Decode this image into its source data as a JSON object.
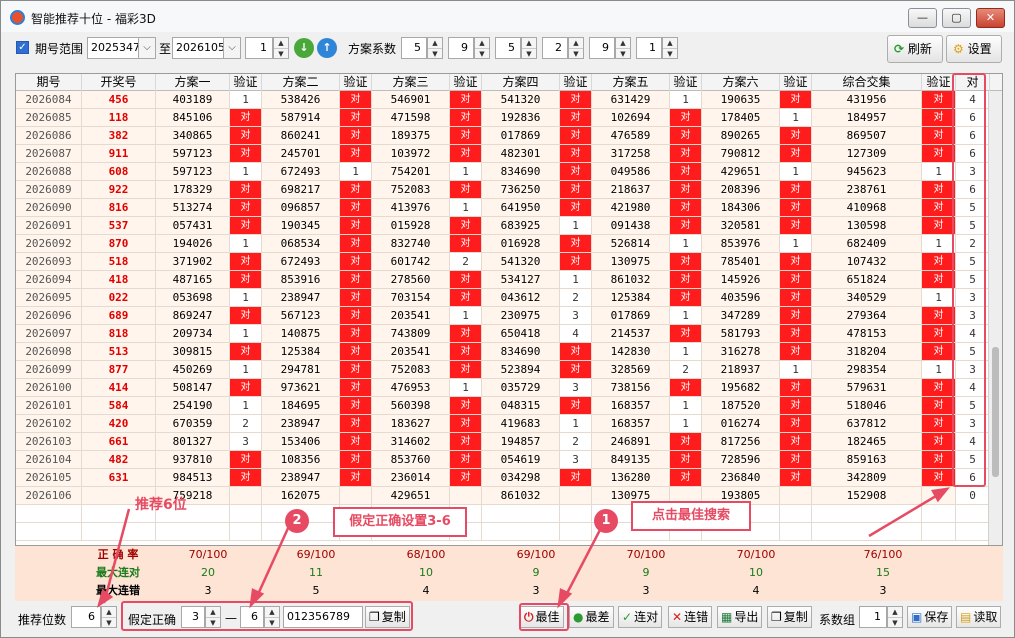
{
  "window": {
    "title": "智能推荐十位 - 福彩3D",
    "min_label": "—",
    "max_label": "▢",
    "close_label": "✕"
  },
  "toolbar": {
    "range_label": "期号范围",
    "range_checked": true,
    "from": "2025347",
    "to_label": "至",
    "to": "2026105",
    "step": "1",
    "coef_label": "方案系数",
    "coefs": [
      "5",
      "9",
      "5",
      "2",
      "9",
      "1"
    ],
    "refresh_label": "刷新",
    "settings_label": "设置"
  },
  "grid": {
    "headers": [
      "期号",
      "开奖号",
      "方案一",
      "验证",
      "方案二",
      "验证",
      "方案三",
      "验证",
      "方案四",
      "验证",
      "方案五",
      "验证",
      "方案六",
      "验证",
      "综合交集",
      "验证",
      "对"
    ],
    "rows": [
      {
        "period": "2026084",
        "draw": "456",
        "plans": [
          "403189",
          "538426",
          "546901",
          "541320",
          "631429",
          "190635",
          "431956"
        ],
        "checks": [
          "1",
          "对",
          "对",
          "对",
          "1",
          "对",
          "对"
        ],
        "count": "4"
      },
      {
        "period": "2026085",
        "draw": "118",
        "plans": [
          "845106",
          "587914",
          "471598",
          "192836",
          "102694",
          "178405",
          "184957"
        ],
        "checks": [
          "对",
          "对",
          "对",
          "对",
          "对",
          "1",
          "对"
        ],
        "count": "6"
      },
      {
        "period": "2026086",
        "draw": "382",
        "plans": [
          "340865",
          "860241",
          "189375",
          "017869",
          "476589",
          "890265",
          "869507"
        ],
        "checks": [
          "对",
          "对",
          "对",
          "对",
          "对",
          "对",
          "对"
        ],
        "count": "6"
      },
      {
        "period": "2026087",
        "draw": "911",
        "plans": [
          "597123",
          "245701",
          "103972",
          "482301",
          "317258",
          "790812",
          "127309"
        ],
        "checks": [
          "对",
          "对",
          "对",
          "对",
          "对",
          "对",
          "对"
        ],
        "count": "6"
      },
      {
        "period": "2026088",
        "draw": "608",
        "plans": [
          "597123",
          "672493",
          "754201",
          "834690",
          "049586",
          "429651",
          "945623"
        ],
        "checks": [
          "1",
          "1",
          "1",
          "对",
          "对",
          "1",
          "1"
        ],
        "count": "3"
      },
      {
        "period": "2026089",
        "draw": "922",
        "plans": [
          "178329",
          "698217",
          "752083",
          "736250",
          "218637",
          "208396",
          "238761"
        ],
        "checks": [
          "对",
          "对",
          "对",
          "对",
          "对",
          "对",
          "对"
        ],
        "count": "6"
      },
      {
        "period": "2026090",
        "draw": "816",
        "plans": [
          "513274",
          "096857",
          "413976",
          "641950",
          "421980",
          "184306",
          "410968"
        ],
        "checks": [
          "对",
          "对",
          "1",
          "对",
          "对",
          "对",
          "对"
        ],
        "count": "5"
      },
      {
        "period": "2026091",
        "draw": "537",
        "plans": [
          "057431",
          "190345",
          "015928",
          "683925",
          "091438",
          "320581",
          "130598"
        ],
        "checks": [
          "对",
          "对",
          "对",
          "1",
          "对",
          "对",
          "对"
        ],
        "count": "5"
      },
      {
        "period": "2026092",
        "draw": "870",
        "plans": [
          "194026",
          "068534",
          "832740",
          "016928",
          "526814",
          "853976",
          "682409"
        ],
        "checks": [
          "1",
          "对",
          "对",
          "对",
          "1",
          "1",
          "1"
        ],
        "count": "2"
      },
      {
        "period": "2026093",
        "draw": "518",
        "plans": [
          "371902",
          "672493",
          "601742",
          "541320",
          "130975",
          "785401",
          "107432"
        ],
        "checks": [
          "对",
          "对",
          "2",
          "对",
          "对",
          "对",
          "对"
        ],
        "count": "5"
      },
      {
        "period": "2026094",
        "draw": "418",
        "plans": [
          "487165",
          "853916",
          "278560",
          "534127",
          "861032",
          "145926",
          "651824"
        ],
        "checks": [
          "对",
          "对",
          "对",
          "1",
          "对",
          "对",
          "对"
        ],
        "count": "5"
      },
      {
        "period": "2026095",
        "draw": "022",
        "plans": [
          "053698",
          "238947",
          "703154",
          "043612",
          "125384",
          "403596",
          "340529"
        ],
        "checks": [
          "1",
          "对",
          "对",
          "2",
          "对",
          "对",
          "1"
        ],
        "count": "3"
      },
      {
        "period": "2026096",
        "draw": "689",
        "plans": [
          "869247",
          "567123",
          "203541",
          "230975",
          "017869",
          "347289",
          "279364"
        ],
        "checks": [
          "对",
          "对",
          "1",
          "3",
          "1",
          "对",
          "对"
        ],
        "count": "3"
      },
      {
        "period": "2026097",
        "draw": "818",
        "plans": [
          "209734",
          "140875",
          "743809",
          "650418",
          "214537",
          "581793",
          "478153"
        ],
        "checks": [
          "1",
          "对",
          "对",
          "4",
          "对",
          "对",
          "对"
        ],
        "count": "4"
      },
      {
        "period": "2026098",
        "draw": "513",
        "plans": [
          "309815",
          "125384",
          "203541",
          "834690",
          "142830",
          "316278",
          "318204"
        ],
        "checks": [
          "对",
          "对",
          "对",
          "对",
          "1",
          "对",
          "对"
        ],
        "count": "5"
      },
      {
        "period": "2026099",
        "draw": "877",
        "plans": [
          "450269",
          "294781",
          "752083",
          "523894",
          "328569",
          "218937",
          "298354"
        ],
        "checks": [
          "1",
          "对",
          "对",
          "对",
          "2",
          "1",
          "1"
        ],
        "count": "3"
      },
      {
        "period": "2026100",
        "draw": "414",
        "plans": [
          "508147",
          "973621",
          "476953",
          "035729",
          "738156",
          "195682",
          "579631"
        ],
        "checks": [
          "对",
          "对",
          "1",
          "3",
          "对",
          "对",
          "对"
        ],
        "count": "4"
      },
      {
        "period": "2026101",
        "draw": "584",
        "plans": [
          "254190",
          "184695",
          "560398",
          "048315",
          "168357",
          "187520",
          "518046"
        ],
        "checks": [
          "1",
          "对",
          "对",
          "对",
          "1",
          "对",
          "对"
        ],
        "count": "5"
      },
      {
        "period": "2026102",
        "draw": "420",
        "plans": [
          "670359",
          "238947",
          "183627",
          "419683",
          "168357",
          "016274",
          "637812"
        ],
        "checks": [
          "2",
          "对",
          "对",
          "1",
          "1",
          "对",
          "对"
        ],
        "count": "3"
      },
      {
        "period": "2026103",
        "draw": "661",
        "plans": [
          "801327",
          "153406",
          "314602",
          "194857",
          "246891",
          "817256",
          "182465"
        ],
        "checks": [
          "3",
          "对",
          "对",
          "2",
          "对",
          "对",
          "对"
        ],
        "count": "4"
      },
      {
        "period": "2026104",
        "draw": "482",
        "plans": [
          "937810",
          "108356",
          "853760",
          "054619",
          "849135",
          "728596",
          "859163"
        ],
        "checks": [
          "对",
          "对",
          "对",
          "3",
          "对",
          "对",
          "对"
        ],
        "count": "5"
      },
      {
        "period": "2026105",
        "draw": "631",
        "plans": [
          "984513",
          "238947",
          "236014",
          "034298",
          "136280",
          "236840",
          "342809"
        ],
        "checks": [
          "对",
          "对",
          "对",
          "对",
          "对",
          "对",
          "对"
        ],
        "count": "6"
      },
      {
        "period": "2026106",
        "draw": "",
        "plans": [
          "759218",
          "162075",
          "429651",
          "861032",
          "130975",
          "193805",
          "152908"
        ],
        "checks": [
          "",
          "",
          "",
          "",
          "",
          "",
          ""
        ],
        "count": "0"
      }
    ]
  },
  "stats": {
    "accuracy_label": "正 确 率",
    "accuracy": [
      "70/100",
      "69/100",
      "68/100",
      "69/100",
      "70/100",
      "70/100",
      "76/100"
    ],
    "max_hit_label": "最大连对",
    "max_hit": [
      "20",
      "11",
      "10",
      "9",
      "9",
      "10",
      "15"
    ],
    "max_miss_label": "最大连错",
    "max_miss": [
      "3",
      "5",
      "4",
      "3",
      "3",
      "4",
      "3"
    ]
  },
  "bottom": {
    "digits_label": "推荐位数",
    "digits": "6",
    "assume_label": "假定正确",
    "assume_from": "3",
    "dash": "—",
    "assume_to": "6",
    "digits_value": "012356789",
    "copy1_label": "复制",
    "best_label": "最佳",
    "worst_label": "最差",
    "hit_label": "连对",
    "miss_label": "连错",
    "export_label": "导出",
    "copy2_label": "复制",
    "coef_group_label": "系数组",
    "coef_group": "1",
    "save_label": "保存",
    "read_label": "读取"
  },
  "annotations": {
    "digits_note": "推荐6位",
    "badge2": "2",
    "assume_note": "假定正确设置3-6",
    "badge1": "1",
    "best_note": "点击最佳搜索"
  }
}
